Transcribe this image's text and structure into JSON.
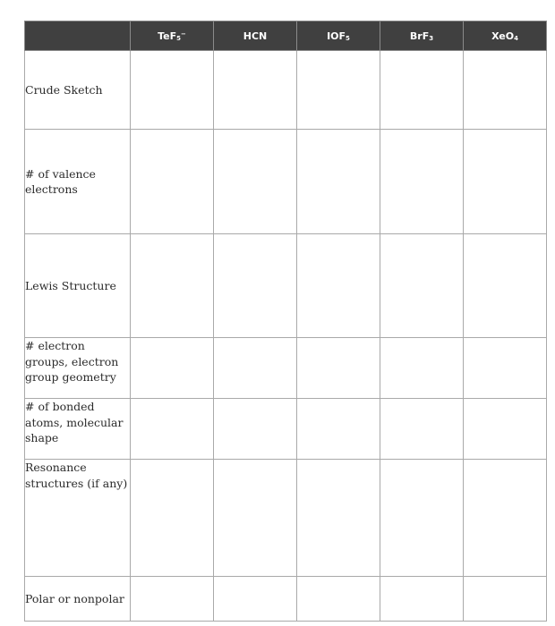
{
  "table": {
    "corner": "",
    "columns": [
      {
        "base": "TeF",
        "sub": "5",
        "sup": "−"
      },
      {
        "base": "HCN",
        "sub": "",
        "sup": ""
      },
      {
        "base": "IOF",
        "sub": "5",
        "sup": ""
      },
      {
        "base": "BrF",
        "sub": "3",
        "sup": ""
      },
      {
        "base": "XeO",
        "sub": "4",
        "sup": ""
      }
    ],
    "rows": [
      {
        "label": "Crude Sketch",
        "cells": [
          "",
          "",
          "",
          "",
          ""
        ]
      },
      {
        "label": "# of valence electrons",
        "cells": [
          "",
          "",
          "",
          "",
          ""
        ]
      },
      {
        "label": "Lewis Structure",
        "cells": [
          "",
          "",
          "",
          "",
          ""
        ]
      },
      {
        "label": "# electron groups, electron group geometry",
        "cells": [
          "",
          "",
          "",
          "",
          ""
        ]
      },
      {
        "label": "# of bonded atoms, molecular shape",
        "cells": [
          "",
          "",
          "",
          "",
          ""
        ]
      },
      {
        "label": "Resonance structures (if any)",
        "cells": [
          "",
          "",
          "",
          "",
          ""
        ]
      },
      {
        "label": "Polar or nonpolar",
        "cells": [
          "",
          "",
          "",
          "",
          ""
        ]
      }
    ]
  },
  "colors": {
    "header_bg": "#404040",
    "header_text": "#ffffff",
    "grid": "#a9a9a9",
    "label_text": "#2b2b2b"
  }
}
